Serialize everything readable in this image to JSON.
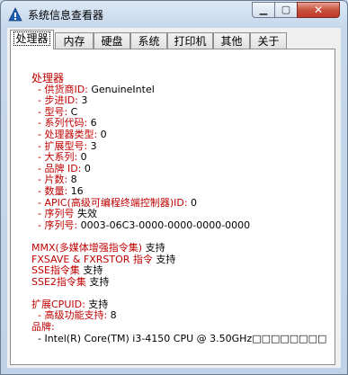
{
  "window": {
    "title": "系统信息查看器"
  },
  "tabs": [
    "处理器",
    "内存",
    "硬盘",
    "系统",
    "打印机",
    "其他",
    "关于"
  ],
  "active_tab": "处理器",
  "processor": {
    "heading": "处理器",
    "fields": [
      {
        "label": "  - 供货商ID: ",
        "value": "GenuineIntel"
      },
      {
        "label": "  - 步进ID: ",
        "value": "3"
      },
      {
        "label": "  - 型号: ",
        "value": "C"
      },
      {
        "label": "  - 系列代码: ",
        "value": "6"
      },
      {
        "label": "  - 处理器类型: ",
        "value": "0"
      },
      {
        "label": "  - 扩展型号: ",
        "value": "3"
      },
      {
        "label": "  - 大系列: ",
        "value": "0"
      },
      {
        "label": "  - 品牌 ID: ",
        "value": "0"
      },
      {
        "label": "  - 片数: ",
        "value": "8"
      },
      {
        "label": "  - 数量: ",
        "value": "16"
      },
      {
        "label": "  - APIC(高级可编程终端控制器)ID: ",
        "value": "0"
      },
      {
        "label": "  - 序列号 ",
        "value": "失效"
      },
      {
        "label": "  - 序列号: ",
        "value": "0003-06C3-0000-0000-0000-0000"
      }
    ],
    "features": [
      {
        "label": "MMX(多媒体增强指令集) ",
        "value": "支持"
      },
      {
        "label": "FXSAVE & FXRSTOR 指令 ",
        "value": "支持"
      },
      {
        "label": "SSE指令集 ",
        "value": "支持"
      },
      {
        "label": "SSE2指令集 ",
        "value": "支持"
      }
    ],
    "ext_cpuid": {
      "label": "扩展CPUID: ",
      "value": "支持"
    },
    "advanced": {
      "label": "  - 高级功能支持: ",
      "value": "8"
    },
    "brand_label": "品牌:",
    "brand_value": "  - Intel(R) Core(TM) i3-4150 CPU @ 3.50GHz□□□□□□□□"
  },
  "colors": {
    "label": "#c00000",
    "value": "#000000",
    "titlebar": "#c7d8ec"
  },
  "icons": {
    "app": "system-info-icon",
    "minimize": "minimize-icon",
    "maximize": "maximize-icon",
    "close": "close-icon"
  }
}
